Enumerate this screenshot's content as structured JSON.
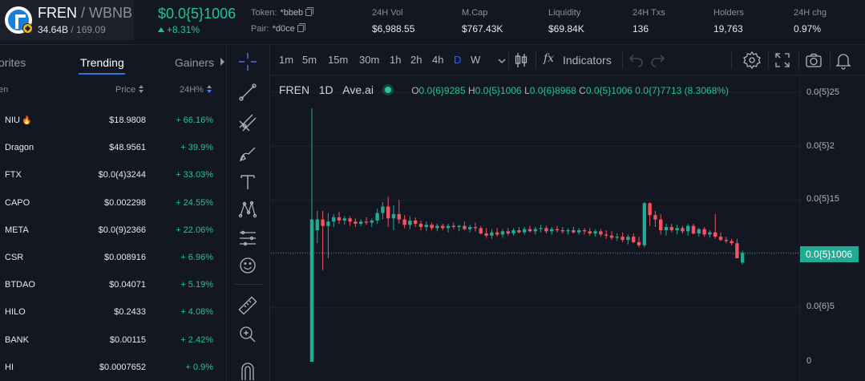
{
  "pair": {
    "base": "FREN",
    "separator": "/",
    "quote": "WBNB",
    "volume_base": "34.64B",
    "volume_quote": "/ 169.09"
  },
  "price": {
    "current": "$0.0{5}1006",
    "change": "+8.31%"
  },
  "token_addr": {
    "label": "Token:",
    "value": "*bbeb"
  },
  "pair_addr": {
    "label": "Pair:",
    "value": "*d0ce"
  },
  "stats": [
    {
      "label": "24H Vol",
      "value": "$6,988.55"
    },
    {
      "label": "M.Cap",
      "value": "$767.43K"
    },
    {
      "label": "Liquidity",
      "value": "$69.84K"
    },
    {
      "label": "24H Txs",
      "value": "136"
    },
    {
      "label": "Holders",
      "value": "19,763"
    },
    {
      "label": "24H chg",
      "value": "0.97%"
    }
  ],
  "left_tabs": {
    "favorites": "orites",
    "trending": "Trending",
    "gainers": "Gainers"
  },
  "columns": {
    "token": "en",
    "price": "Price",
    "change": "24H%"
  },
  "tokens": [
    {
      "symbol": "NIU",
      "hot": true,
      "price": "$18.9808",
      "change": "+ 66.16%"
    },
    {
      "symbol": "Dragon",
      "hot": false,
      "price": "$48.9561",
      "change": "+ 39.9%"
    },
    {
      "symbol": "FTX",
      "hot": false,
      "price": "$0.0(4)3244",
      "change": "+ 33.03%"
    },
    {
      "symbol": "CAPO",
      "hot": false,
      "price": "$0.002298",
      "change": "+ 24.55%"
    },
    {
      "symbol": "META",
      "hot": false,
      "price": "$0.0(9)2366",
      "change": "+ 22.06%"
    },
    {
      "symbol": "CSR",
      "hot": false,
      "price": "$0.008916",
      "change": "+ 6.96%"
    },
    {
      "symbol": "BTDAO",
      "hot": false,
      "price": "$0.04071",
      "change": "+ 5.19%"
    },
    {
      "symbol": "HILO",
      "hot": false,
      "price": "$0.2433",
      "change": "+ 4.08%"
    },
    {
      "symbol": "BANK",
      "hot": false,
      "price": "$0.00115",
      "change": "+ 2.42%"
    },
    {
      "symbol": "HI",
      "hot": false,
      "price": "$0.0007652",
      "change": "+ 0.9%"
    }
  ],
  "timeframes": [
    "1m",
    "5m",
    "15m",
    "30m",
    "1h",
    "2h",
    "4h",
    "D",
    "W"
  ],
  "active_timeframe": "D",
  "indicators_label": "Indicators",
  "fx_label": "fx",
  "legend": {
    "symbol": "FREN",
    "interval": "1D",
    "source": "Ave.ai",
    "o_label": "O",
    "o": "0.0{6}9285",
    "h_label": "H",
    "h": "0.0{5}1006",
    "l_label": "L",
    "l": "0.0{6}8968",
    "c_label": "C",
    "c": "0.0{5}1006",
    "change": "0.0{7}7713 (8.3068%)"
  },
  "y_axis": [
    "0.0{5}25",
    "0.0{5}2",
    "0.0{5}15",
    "0.0{5}1",
    "0.0{6}5",
    "0"
  ],
  "last_price_tag": "0.0{5}1006",
  "colors": {
    "up": "#22ab94",
    "down": "#f7525f",
    "accent": "#2962ff",
    "grid": "#1f2330"
  },
  "chart_data": {
    "type": "candlestick",
    "symbol": "FREN/WBNB",
    "interval": "1D",
    "ylim": [
      0,
      2.6e-06
    ],
    "candles": [
      {
        "o": 0.0,
        "h": 2.35e-06,
        "l": 0.0,
        "c": 1.32e-06
      },
      {
        "o": 1.22e-06,
        "h": 1.4e-06,
        "l": 1.1e-06,
        "c": 1.32e-06
      },
      {
        "o": 1.32e-06,
        "h": 1.4e-06,
        "l": 8.5e-07,
        "c": 1.26e-06
      },
      {
        "o": 1.26e-06,
        "h": 1.38e-06,
        "l": 9.6e-07,
        "c": 1.3e-06
      },
      {
        "o": 1.3e-06,
        "h": 1.37e-06,
        "l": 1.25e-06,
        "c": 1.34e-06
      },
      {
        "o": 1.34e-06,
        "h": 1.39e-06,
        "l": 1.28e-06,
        "c": 1.31e-06
      },
      {
        "o": 1.31e-06,
        "h": 1.35e-06,
        "l": 1.27e-06,
        "c": 1.33e-06
      },
      {
        "o": 1.33e-06,
        "h": 1.35e-06,
        "l": 1.26e-06,
        "c": 1.3e-06
      },
      {
        "o": 1.3e-06,
        "h": 1.33e-06,
        "l": 1.25e-06,
        "c": 1.28e-06
      },
      {
        "o": 1.28e-06,
        "h": 1.32e-06,
        "l": 1.26e-06,
        "c": 1.3e-06
      },
      {
        "o": 1.3e-06,
        "h": 1.34e-06,
        "l": 1.27e-06,
        "c": 1.29e-06
      },
      {
        "o": 1.29e-06,
        "h": 1.33e-06,
        "l": 1.25e-06,
        "c": 1.31e-06
      },
      {
        "o": 1.31e-06,
        "h": 1.42e-06,
        "l": 1.28e-06,
        "c": 1.38e-06
      },
      {
        "o": 1.38e-06,
        "h": 1.48e-06,
        "l": 1.32e-06,
        "c": 1.44e-06
      },
      {
        "o": 1.44e-06,
        "h": 1.53e-06,
        "l": 1.25e-06,
        "c": 1.33e-06
      },
      {
        "o": 1.33e-06,
        "h": 1.45e-06,
        "l": 1.22e-06,
        "c": 1.37e-06
      },
      {
        "o": 1.37e-06,
        "h": 1.5e-06,
        "l": 1.28e-06,
        "c": 1.32e-06
      },
      {
        "o": 1.32e-06,
        "h": 1.36e-06,
        "l": 1.24e-06,
        "c": 1.27e-06
      },
      {
        "o": 1.27e-06,
        "h": 1.35e-06,
        "l": 1.23e-06,
        "c": 1.31e-06
      },
      {
        "o": 1.31e-06,
        "h": 1.34e-06,
        "l": 1.25e-06,
        "c": 1.28e-06
      },
      {
        "o": 1.28e-06,
        "h": 1.31e-06,
        "l": 1.22e-06,
        "c": 1.25e-06
      },
      {
        "o": 1.25e-06,
        "h": 1.3e-06,
        "l": 1.21e-06,
        "c": 1.27e-06
      },
      {
        "o": 1.27e-06,
        "h": 1.29e-06,
        "l": 1.22e-06,
        "c": 1.24e-06
      },
      {
        "o": 1.24e-06,
        "h": 1.28e-06,
        "l": 1.21e-06,
        "c": 1.26e-06
      },
      {
        "o": 1.26e-06,
        "h": 1.28e-06,
        "l": 1.22e-06,
        "c": 1.24e-06
      },
      {
        "o": 1.24e-06,
        "h": 1.28e-06,
        "l": 1.2e-06,
        "c": 1.26e-06
      },
      {
        "o": 1.26e-06,
        "h": 1.29e-06,
        "l": 1.23e-06,
        "c": 1.25e-06
      },
      {
        "o": 1.25e-06,
        "h": 1.27e-06,
        "l": 1.21e-06,
        "c": 1.26e-06
      },
      {
        "o": 1.26e-06,
        "h": 1.3e-06,
        "l": 1.22e-06,
        "c": 1.23e-06
      },
      {
        "o": 1.23e-06,
        "h": 1.27e-06,
        "l": 1.2e-06,
        "c": 1.25e-06
      },
      {
        "o": 1.25e-06,
        "h": 1.29e-06,
        "l": 1.21e-06,
        "c": 1.24e-06
      },
      {
        "o": 1.24e-06,
        "h": 1.26e-06,
        "l": 1.18e-06,
        "c": 1.19e-06
      },
      {
        "o": 1.19e-06,
        "h": 1.24e-06,
        "l": 1.15e-06,
        "c": 1.17e-06
      },
      {
        "o": 1.17e-06,
        "h": 1.23e-06,
        "l": 1.14e-06,
        "c": 1.2e-06
      },
      {
        "o": 1.2e-06,
        "h": 1.24e-06,
        "l": 1.16e-06,
        "c": 1.18e-06
      },
      {
        "o": 1.18e-06,
        "h": 1.23e-06,
        "l": 1.15e-06,
        "c": 1.21e-06
      },
      {
        "o": 1.21e-06,
        "h": 1.24e-06,
        "l": 1.17e-06,
        "c": 1.19e-06
      },
      {
        "o": 1.19e-06,
        "h": 1.24e-06,
        "l": 1.17e-06,
        "c": 1.22e-06
      },
      {
        "o": 1.22e-06,
        "h": 1.25e-06,
        "l": 1.19e-06,
        "c": 1.2e-06
      },
      {
        "o": 1.2e-06,
        "h": 1.25e-06,
        "l": 1.18e-06,
        "c": 1.23e-06
      },
      {
        "o": 1.23e-06,
        "h": 1.26e-06,
        "l": 1.2e-06,
        "c": 1.21e-06
      },
      {
        "o": 1.21e-06,
        "h": 1.25e-06,
        "l": 1.18e-06,
        "c": 1.23e-06
      },
      {
        "o": 1.23e-06,
        "h": 1.27e-06,
        "l": 1.2e-06,
        "c": 1.24e-06
      },
      {
        "o": 1.24e-06,
        "h": 1.26e-06,
        "l": 1.19e-06,
        "c": 1.21e-06
      },
      {
        "o": 1.21e-06,
        "h": 1.25e-06,
        "l": 1.18e-06,
        "c": 1.23e-06
      },
      {
        "o": 1.23e-06,
        "h": 1.26e-06,
        "l": 1.2e-06,
        "c": 1.22e-06
      },
      {
        "o": 1.22e-06,
        "h": 1.25e-06,
        "l": 1.19e-06,
        "c": 1.21e-06
      },
      {
        "o": 1.21e-06,
        "h": 1.24e-06,
        "l": 1.18e-06,
        "c": 1.22e-06
      },
      {
        "o": 1.22e-06,
        "h": 1.25e-06,
        "l": 1.19e-06,
        "c": 1.2e-06
      },
      {
        "o": 1.2e-06,
        "h": 1.24e-06,
        "l": 1.18e-06,
        "c": 1.22e-06
      },
      {
        "o": 1.22e-06,
        "h": 1.24e-06,
        "l": 1.18e-06,
        "c": 1.21e-06
      },
      {
        "o": 1.21e-06,
        "h": 1.24e-06,
        "l": 1.17e-06,
        "c": 1.19e-06
      },
      {
        "o": 1.19e-06,
        "h": 1.23e-06,
        "l": 1.16e-06,
        "c": 1.21e-06
      },
      {
        "o": 1.21e-06,
        "h": 1.23e-06,
        "l": 1.16e-06,
        "c": 1.18e-06
      },
      {
        "o": 1.18e-06,
        "h": 1.22e-06,
        "l": 1.14e-06,
        "c": 1.17e-06
      },
      {
        "o": 1.17e-06,
        "h": 1.21e-06,
        "l": 1.13e-06,
        "c": 1.15e-06
      },
      {
        "o": 1.15e-06,
        "h": 1.19e-06,
        "l": 1.12e-06,
        "c": 1.16e-06
      },
      {
        "o": 1.16e-06,
        "h": 1.2e-06,
        "l": 1.11e-06,
        "c": 1.13e-06
      },
      {
        "o": 1.13e-06,
        "h": 1.18e-06,
        "l": 1.09e-06,
        "c": 1.16e-06
      },
      {
        "o": 1.16e-06,
        "h": 1.19e-06,
        "l": 1.1e-06,
        "c": 1.11e-06
      },
      {
        "o": 1.11e-06,
        "h": 1.16e-06,
        "l": 1.06e-06,
        "c": 1.08e-06
      },
      {
        "o": 1.08e-06,
        "h": 1.48e-06,
        "l": 1.06e-06,
        "c": 1.47e-06
      },
      {
        "o": 1.47e-06,
        "h": 1.48e-06,
        "l": 1.26e-06,
        "c": 1.36e-06
      },
      {
        "o": 1.36e-06,
        "h": 1.4e-06,
        "l": 1.25e-06,
        "c": 1.32e-06
      },
      {
        "o": 1.32e-06,
        "h": 1.37e-06,
        "l": 1.18e-06,
        "c": 1.22e-06
      },
      {
        "o": 1.22e-06,
        "h": 1.28e-06,
        "l": 1.17e-06,
        "c": 1.25e-06
      },
      {
        "o": 1.25e-06,
        "h": 1.28e-06,
        "l": 1.2e-06,
        "c": 1.22e-06
      },
      {
        "o": 1.22e-06,
        "h": 1.27e-06,
        "l": 1.18e-06,
        "c": 1.24e-06
      },
      {
        "o": 1.24e-06,
        "h": 1.26e-06,
        "l": 1.19e-06,
        "c": 1.21e-06
      },
      {
        "o": 1.21e-06,
        "h": 1.28e-06,
        "l": 1.17e-06,
        "c": 1.26e-06
      },
      {
        "o": 1.26e-06,
        "h": 1.28e-06,
        "l": 1.18e-06,
        "c": 1.19e-06
      },
      {
        "o": 1.19e-06,
        "h": 1.24e-06,
        "l": 1.16e-06,
        "c": 1.23e-06
      },
      {
        "o": 1.23e-06,
        "h": 1.25e-06,
        "l": 1.16e-06,
        "c": 1.18e-06
      },
      {
        "o": 1.18e-06,
        "h": 1.22e-06,
        "l": 1.15e-06,
        "c": 1.2e-06
      },
      {
        "o": 1.2e-06,
        "h": 1.37e-06,
        "l": 1.14e-06,
        "c": 1.16e-06
      },
      {
        "o": 1.16e-06,
        "h": 1.2e-06,
        "l": 1.12e-06,
        "c": 1.13e-06
      },
      {
        "o": 1.13e-06,
        "h": 1.16e-06,
        "l": 1.1e-06,
        "c": 1.12e-06
      },
      {
        "o": 1.12e-06,
        "h": 1.14e-06,
        "l": 1.08e-06,
        "c": 1.1e-06
      },
      {
        "o": 1.1e-06,
        "h": 1.14e-06,
        "l": 9.6e-07,
        "c": 9.6e-07
      },
      {
        "o": 9.2e-07,
        "h": 1.03e-06,
        "l": 9e-07,
        "c": 1.01e-06
      }
    ]
  }
}
